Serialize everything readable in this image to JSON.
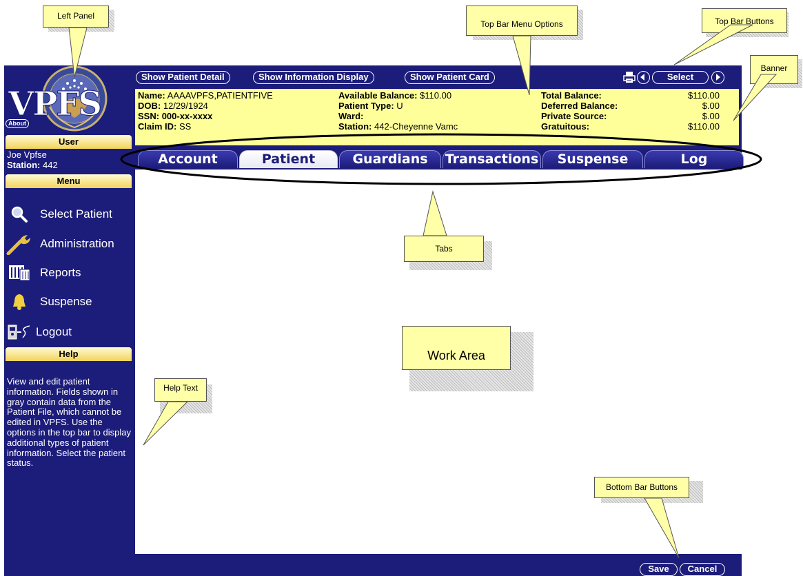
{
  "left_panel": {
    "logo_text": "VPFS",
    "about_label": "About",
    "user_header": "User",
    "user_name": "Joe Vpfse",
    "station_label": "Station:",
    "station_value": "442",
    "menu_header": "Menu",
    "menu_items": [
      {
        "label": "Select Patient",
        "icon": "magnifier-icon"
      },
      {
        "label": "Administration",
        "icon": "wrench-icon"
      },
      {
        "label": "Reports",
        "icon": "reports-icon"
      },
      {
        "label": "Suspense",
        "icon": "bell-icon"
      },
      {
        "label": "Logout",
        "icon": "logout-icon"
      }
    ],
    "help_header": "Help",
    "help_text": "View and edit patient information. Fields shown in gray contain data from the Patient File, which cannot be edited in VPFS. Use the options in the top bar to display additional types of patient information. Select the patient status."
  },
  "top_bar": {
    "show_patient_detail": "Show Patient Detail",
    "show_information_display": "Show Information Display",
    "show_patient_card": "Show Patient Card",
    "select_label": "Select",
    "icons": [
      "print-icon",
      "prev-arrow-icon",
      "next-arrow-icon"
    ]
  },
  "banner": {
    "name_label": "Name:",
    "name_value": "AAAAVPFS,PATIENTFIVE",
    "dob_label": "DOB:",
    "dob_value": "12/29/1924",
    "ssn_label": "SSN:",
    "ssn_value": "000-xx-xxxx",
    "claim_label": "Claim ID:",
    "claim_value": "SS",
    "avail_label": "Available Balance:",
    "avail_value": "$110.00",
    "ptype_label": "Patient Type:",
    "ptype_value": "U",
    "ward_label": "Ward:",
    "ward_value": "",
    "station_label": "Station:",
    "station_value": "442-Cheyenne Vamc",
    "total_label": "Total Balance:",
    "total_value": "$110.00",
    "deferred_label": "Deferred Balance:",
    "deferred_value": "$.00",
    "private_label": "Private Source:",
    "private_value": "$.00",
    "gratuitous_label": "Gratuitous:",
    "gratuitous_value": "$110.00"
  },
  "tabs": [
    {
      "label": "Account",
      "active": false
    },
    {
      "label": "Patient",
      "active": true
    },
    {
      "label": "Guardians",
      "active": false
    },
    {
      "label": "Transactions",
      "active": false
    },
    {
      "label": "Suspense",
      "active": false
    },
    {
      "label": "Log",
      "active": false
    }
  ],
  "bottom_bar": {
    "save_label": "Save",
    "cancel_label": "Cancel"
  },
  "callouts": {
    "left_panel": "Left Panel",
    "top_bar_menu_options": "Top Bar Menu Options",
    "top_bar_buttons": "Top Bar Buttons",
    "banner": "Banner",
    "tabs": "Tabs",
    "work_area": "Work Area",
    "help_text": "Help Text",
    "bottom_bar_buttons": "Bottom Bar Buttons"
  },
  "colors": {
    "frame_navy": "#1c1c7a",
    "banner_yellow": "#ffff9a",
    "section_header_gold": "#f2d35a",
    "callout_yellow": "#ffffa8"
  }
}
